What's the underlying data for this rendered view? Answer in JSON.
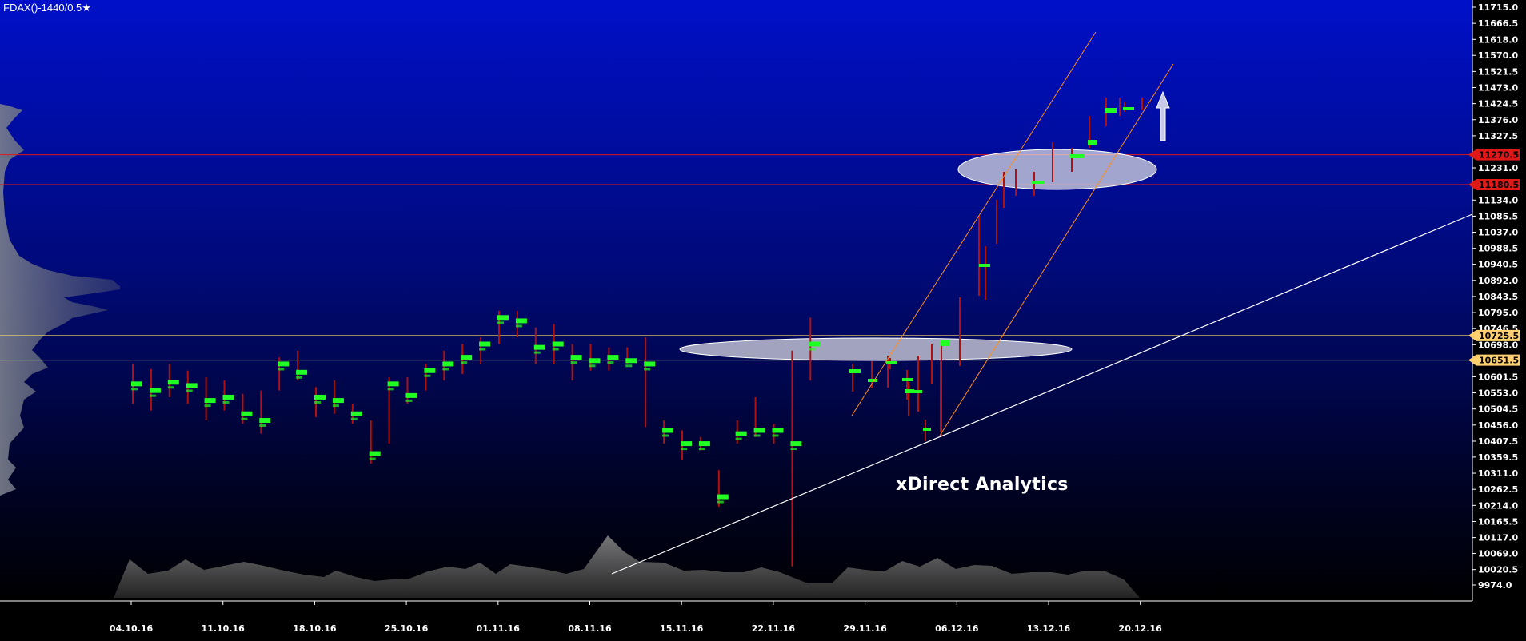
{
  "title": "FDAX()-1440/0.5",
  "star_icon": "star-icon",
  "watermark": "xDirect Analytics",
  "colors": {
    "bg_top": "#0010c8",
    "bg_bottom": "#000000",
    "support_resistance_red": "#e01818",
    "support_resistance_yellow": "#ffd070",
    "channel": "#ff8c1a",
    "trendline": "#ffffff",
    "bar_body": "#22ff22",
    "bar_wick": "#b01010",
    "arrow": "#c8c8e8"
  },
  "chart_data": {
    "type": "candlestick-volume-profile",
    "y_ticks": [
      "11715.0",
      "11666.5",
      "11618.0",
      "11570.0",
      "11521.5",
      "11473.0",
      "11424.5",
      "11376.0",
      "11327.5",
      "11231.0",
      "11134.0",
      "11085.5",
      "11037.0",
      "10988.5",
      "10940.5",
      "10892.0",
      "10843.5",
      "10795.0",
      "10746.5",
      "10698.0",
      "10601.5",
      "10553.0",
      "10504.5",
      "10456.0",
      "10407.5",
      "10359.5",
      "10311.0",
      "10262.5",
      "10214.0",
      "10165.5",
      "10117.0",
      "10069.0",
      "10020.5",
      "9974.0"
    ],
    "x_ticks": [
      "04.10.16",
      "11.10.16",
      "18.10.16",
      "25.10.16",
      "01.11.16",
      "08.11.16",
      "15.11.16",
      "22.11.16",
      "29.11.16",
      "06.12.16",
      "13.12.16",
      "20.12.16"
    ],
    "ylim": [
      9974.0,
      11715.0
    ],
    "levels": [
      {
        "label": "11270.5",
        "value": 11270.5,
        "color": "#e01818"
      },
      {
        "label": "11180.5",
        "value": 11180.5,
        "color": "#e01818"
      },
      {
        "label": "10725.5",
        "value": 10725.5,
        "color": "#ffd070"
      },
      {
        "label": "10651.5",
        "value": 10651.5,
        "color": "#ffd070"
      }
    ],
    "bars": [
      {
        "date": "04.10.16",
        "low": 10520,
        "high": 10640,
        "close": 10580
      },
      {
        "date": "05.10.16",
        "low": 10500,
        "high": 10625,
        "close": 10560
      },
      {
        "date": "06.10.16",
        "low": 10540,
        "high": 10640,
        "close": 10585
      },
      {
        "date": "07.10.16",
        "low": 10520,
        "high": 10620,
        "close": 10575
      },
      {
        "date": "10.10.16",
        "low": 10470,
        "high": 10600,
        "close": 10530
      },
      {
        "date": "11.10.16",
        "low": 10500,
        "high": 10590,
        "close": 10540
      },
      {
        "date": "12.10.16",
        "low": 10460,
        "high": 10550,
        "close": 10490
      },
      {
        "date": "13.10.16",
        "low": 10430,
        "high": 10560,
        "close": 10470
      },
      {
        "date": "14.10.16",
        "low": 10560,
        "high": 10660,
        "close": 10640
      },
      {
        "date": "17.10.16",
        "low": 10590,
        "high": 10680,
        "close": 10615
      },
      {
        "date": "18.10.16",
        "low": 10480,
        "high": 10570,
        "close": 10540
      },
      {
        "date": "19.10.16",
        "low": 10490,
        "high": 10590,
        "close": 10530
      },
      {
        "date": "20.10.16",
        "low": 10460,
        "high": 10520,
        "close": 10490
      },
      {
        "date": "21.10.16",
        "low": 10340,
        "high": 10470,
        "close": 10370
      },
      {
        "date": "24.10.16",
        "low": 10400,
        "high": 10600,
        "close": 10580
      },
      {
        "date": "25.10.16",
        "low": 10520,
        "high": 10600,
        "close": 10545
      },
      {
        "date": "26.10.16",
        "low": 10560,
        "high": 10640,
        "close": 10620
      },
      {
        "date": "27.10.16",
        "low": 10590,
        "high": 10680,
        "close": 10640
      },
      {
        "date": "28.10.16",
        "low": 10610,
        "high": 10700,
        "close": 10660
      },
      {
        "date": "31.10.16",
        "low": 10640,
        "high": 10720,
        "close": 10700
      },
      {
        "date": "01.11.16",
        "low": 10700,
        "high": 10800,
        "close": 10780
      },
      {
        "date": "02.11.16",
        "low": 10720,
        "high": 10800,
        "close": 10770
      },
      {
        "date": "03.11.16",
        "low": 10640,
        "high": 10750,
        "close": 10690
      },
      {
        "date": "04.11.16",
        "low": 10640,
        "high": 10760,
        "close": 10700
      },
      {
        "date": "07.11.16",
        "low": 10590,
        "high": 10700,
        "close": 10660
      },
      {
        "date": "08.11.16",
        "low": 10620,
        "high": 10700,
        "close": 10650
      },
      {
        "date": "09.11.16",
        "low": 10620,
        "high": 10690,
        "close": 10660
      },
      {
        "date": "10.11.16",
        "low": 10640,
        "high": 10690,
        "close": 10650
      },
      {
        "date": "11.11.16",
        "low": 10450,
        "high": 10720,
        "close": 10640
      },
      {
        "date": "14.11.16",
        "low": 10400,
        "high": 10470,
        "close": 10440
      },
      {
        "date": "15.11.16",
        "low": 10350,
        "high": 10440,
        "close": 10400
      },
      {
        "date": "16.11.16",
        "low": 10380,
        "high": 10420,
        "close": 10400
      },
      {
        "date": "17.11.16",
        "low": 10210,
        "high": 10320,
        "close": 10240
      },
      {
        "date": "18.11.16",
        "low": 10400,
        "high": 10470,
        "close": 10430
      },
      {
        "date": "21.11.16",
        "low": 10420,
        "high": 10540,
        "close": 10440
      },
      {
        "date": "22.11.16",
        "low": 10400,
        "high": 10460,
        "close": 10440
      },
      {
        "date": "23.11.16",
        "low": 10030,
        "high": 10680,
        "close": 10400
      },
      {
        "date": "24.11.16",
        "low": 10590,
        "high": 10780,
        "close": 10700
      }
    ]
  }
}
